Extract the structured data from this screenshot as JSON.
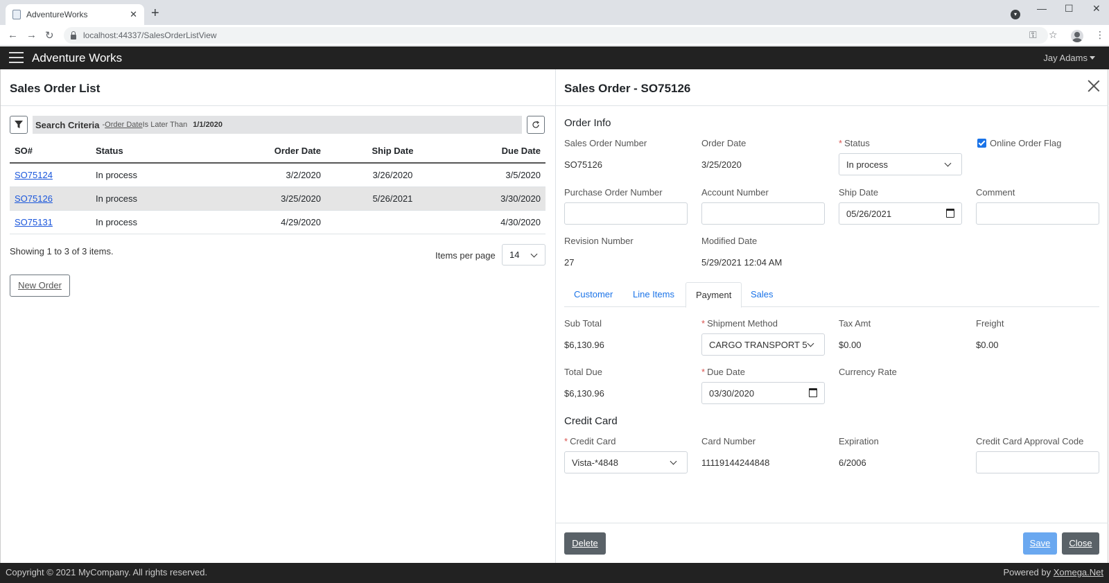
{
  "browser": {
    "tab_title": "AdventureWorks",
    "url": "localhost:44337/SalesOrderListView"
  },
  "navbar": {
    "brand": "Adventure Works",
    "user": "Jay Adams"
  },
  "list": {
    "title": "Sales Order List",
    "search": {
      "label": "Search Criteria",
      "dash": "- ",
      "field": "Order Date",
      "op": " Is Later Than",
      "value": "1/1/2020"
    },
    "columns": [
      "SO#",
      "Status",
      "Order Date",
      "Ship Date",
      "Due Date"
    ],
    "rows": [
      {
        "so": "SO75124",
        "status": "In process",
        "order_date": "3/2/2020",
        "ship_date": "3/26/2020",
        "due_date": "3/5/2020"
      },
      {
        "so": "SO75126",
        "status": "In process",
        "order_date": "3/25/2020",
        "ship_date": "5/26/2021",
        "due_date": "3/30/2020"
      },
      {
        "so": "SO75131",
        "status": "In process",
        "order_date": "4/29/2020",
        "ship_date": "",
        "due_date": "4/30/2020"
      }
    ],
    "selected_row": 1,
    "showing": "Showing 1 to 3 of 3 items.",
    "items_per_page_label": "Items per page",
    "items_per_page": "14",
    "new_order": "New Order"
  },
  "detail": {
    "title": "Sales Order - SO75126",
    "order_info": {
      "heading": "Order Info",
      "sales_order_number_label": "Sales Order Number",
      "sales_order_number": "SO75126",
      "order_date_label": "Order Date",
      "order_date": "3/25/2020",
      "status_label": "Status",
      "status": "In process",
      "online_flag_label": "Online Order Flag",
      "online_flag": true,
      "po_number_label": "Purchase Order Number",
      "po_number": "",
      "account_number_label": "Account Number",
      "account_number": "",
      "ship_date_label": "Ship Date",
      "ship_date": "05/26/2021",
      "comment_label": "Comment",
      "comment": "",
      "revision_label": "Revision Number",
      "revision": "27",
      "modified_label": "Modified Date",
      "modified": "5/29/2021 12:04 AM"
    },
    "tabs": [
      "Customer",
      "Line Items",
      "Payment",
      "Sales"
    ],
    "active_tab": "Payment",
    "payment": {
      "sub_total_label": "Sub Total",
      "sub_total": "$6,130.96",
      "shipment_method_label": "Shipment Method",
      "shipment_method": "CARGO TRANSPORT 5",
      "tax_label": "Tax Amt",
      "tax": "$0.00",
      "freight_label": "Freight",
      "freight": "$0.00",
      "total_due_label": "Total Due",
      "total_due": "$6,130.96",
      "due_date_label": "Due Date",
      "due_date": "03/30/2020",
      "currency_rate_label": "Currency Rate"
    },
    "credit_card": {
      "heading": "Credit Card",
      "card_label": "Credit Card",
      "card": "Vista-*4848",
      "card_number_label": "Card Number",
      "card_number": "11119144244848",
      "expiration_label": "Expiration",
      "expiration": "6/2006",
      "approval_label": "Credit Card Approval Code",
      "approval": ""
    },
    "buttons": {
      "delete": "Delete",
      "save": "Save",
      "close": "Close"
    }
  },
  "footer": {
    "copyright": "Copyright © 2021 MyCompany. All rights reserved.",
    "powered_by": "Powered by ",
    "powered_link": "Xomega.Net"
  },
  "colors": {
    "navbar": "#222222",
    "link": "#1a56db",
    "save_button": "#6aa8f0",
    "delete_button": "#5a6268",
    "required": "#d9534f"
  }
}
